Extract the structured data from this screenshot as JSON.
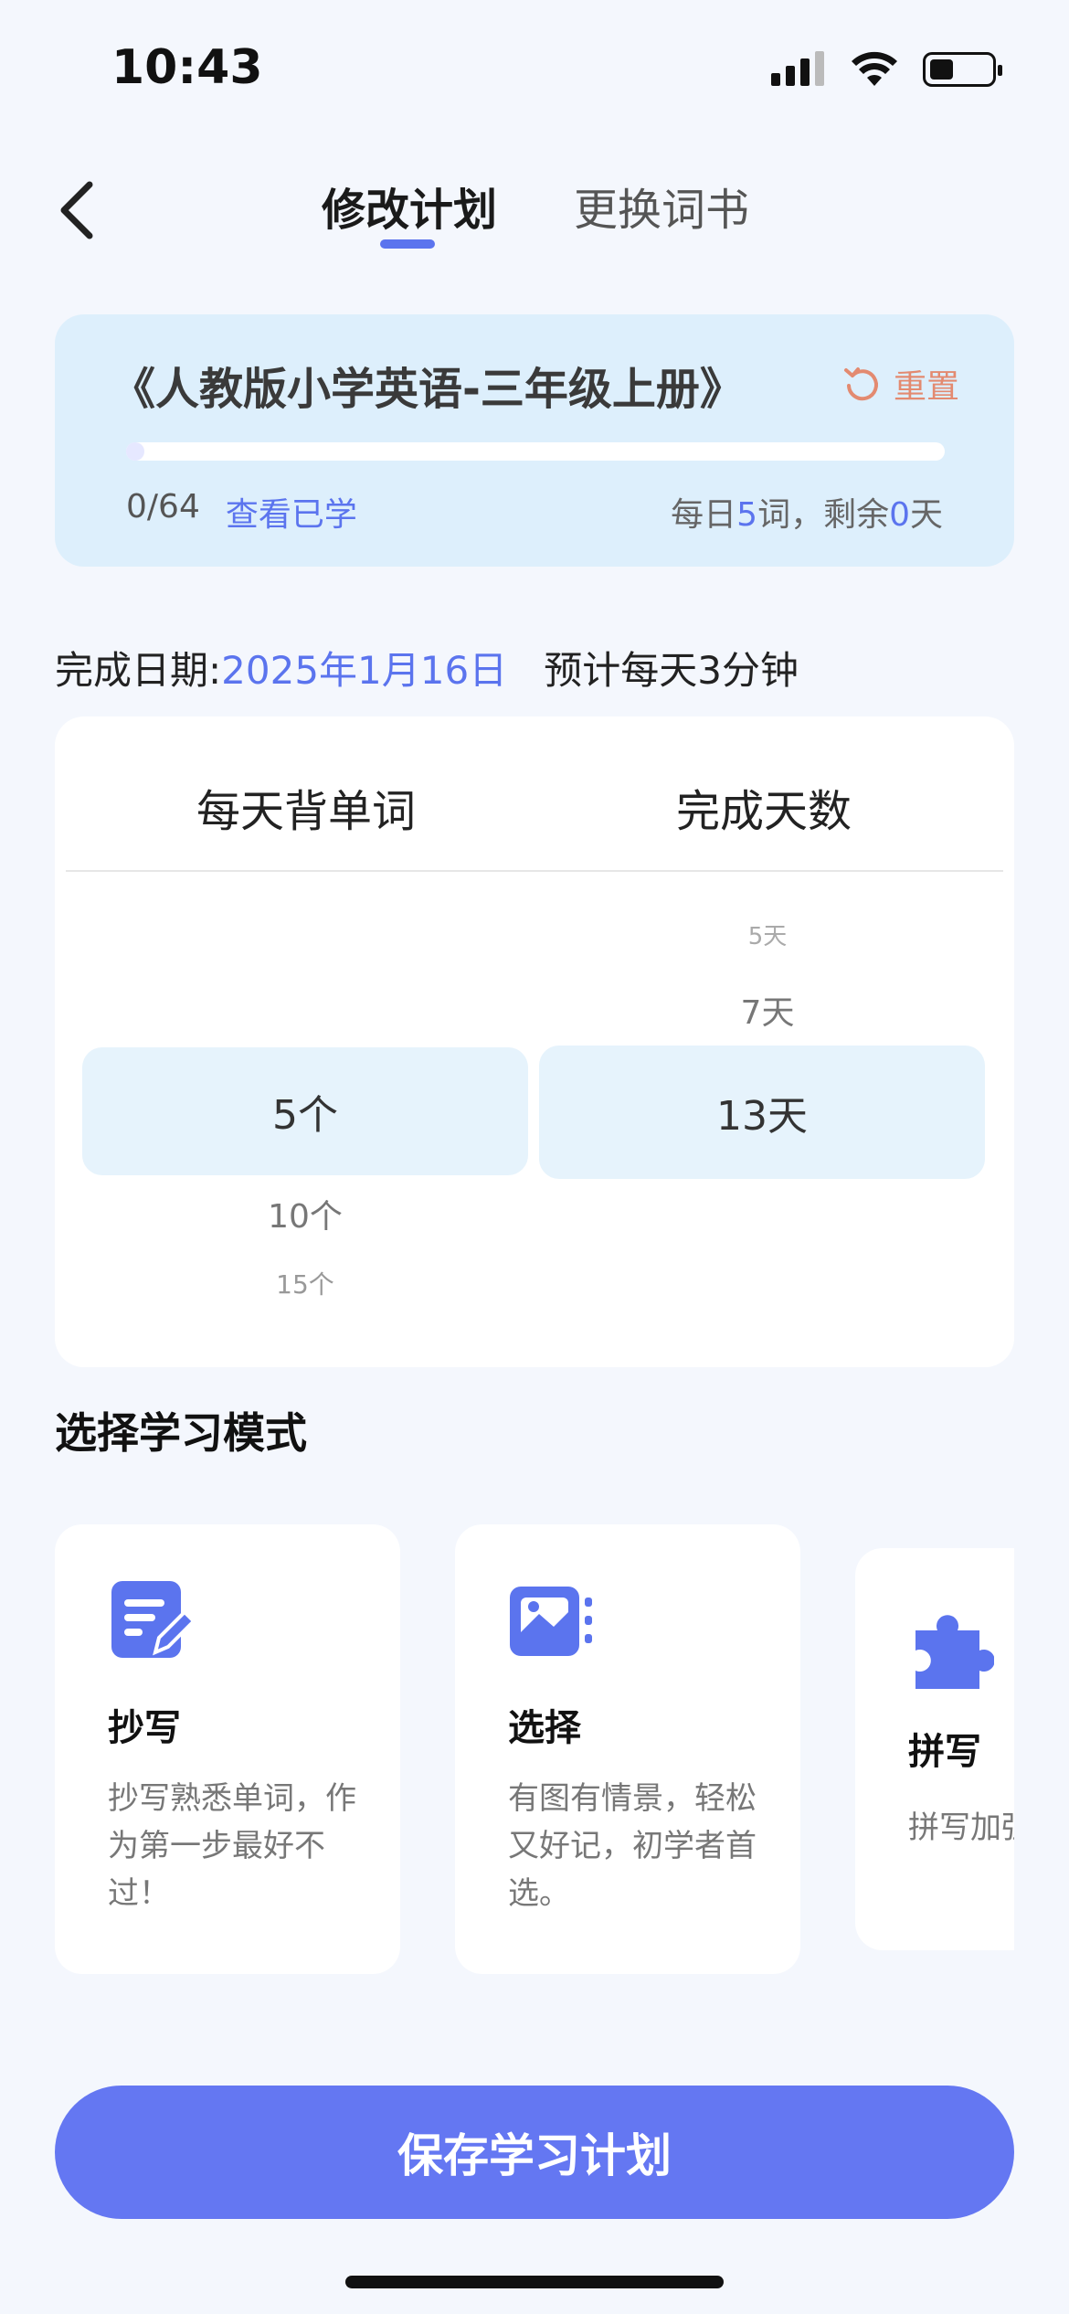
{
  "status_bar": {
    "time": "10:43"
  },
  "header": {
    "tabs": [
      {
        "label": "修改计划",
        "active": true
      },
      {
        "label": "更换词书",
        "active": false
      }
    ]
  },
  "book": {
    "title": "《人教版小学英语-三年级上册》",
    "reset_label": "重置",
    "progress_text": "0/64",
    "progress_fraction": 0,
    "view_learned_label": "查看已学",
    "daily_prefix": "每日",
    "daily_words": "5",
    "daily_mid": "词，剩余",
    "remaining_days": "0",
    "daily_suffix": "天"
  },
  "completion": {
    "label": "完成日期:",
    "date": "2025年1月16日",
    "estimate": "预计每天3分钟"
  },
  "picker": {
    "left_header": "每天背单词",
    "right_header": "完成天数",
    "left_selected": "5个",
    "left_below": [
      "10个",
      "15个"
    ],
    "right_above": [
      "5天",
      "7天"
    ],
    "right_selected": "13天"
  },
  "modes": {
    "section_title": "选择学习模式",
    "cards": [
      {
        "title": "抄写",
        "desc": "抄写熟悉单词，作为第一步最好不过！",
        "icon": "pencil-note-icon"
      },
      {
        "title": "选择",
        "desc": "有图有情景，轻松又好记，初学者首选。",
        "icon": "picture-card-icon"
      },
      {
        "title": "拼写",
        "desc": "拼写加强记忆，可以完全掌握",
        "icon": "puzzle-icon"
      }
    ]
  },
  "save_label": "保存学习计划",
  "colors": {
    "accent": "#5B74EE",
    "card_bg": "#DDEFFC",
    "reset": "#E38A70",
    "button": "#6477F2"
  }
}
